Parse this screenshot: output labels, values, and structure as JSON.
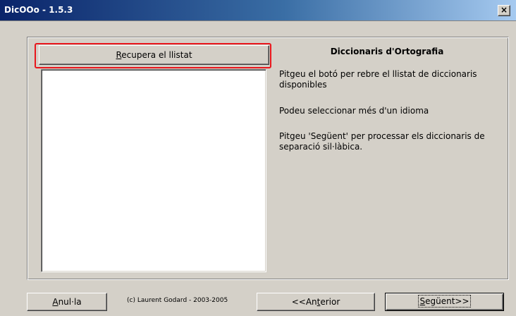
{
  "window": {
    "title": "DicOOo - 1.5.3",
    "close_symbol": "×",
    "close_icon": "close-icon"
  },
  "left_panel": {
    "retrieve_button": {
      "accel": "R",
      "rest": "ecupera el llistat"
    },
    "highlight_color": "#e8161c",
    "dictionary_list_items": []
  },
  "right_panel": {
    "heading": "Diccionaris d'Ortografia",
    "instruction_1": "Pitgeu el botó per rebre el llistat de diccionaris disponibles",
    "instruction_2": "Podeu seleccionar més d'un idioma",
    "instruction_3": "Pitgeu 'Següent' per processar els diccionaris de separació sil·làbica."
  },
  "footer": {
    "cancel_button": {
      "accel": "A",
      "rest": "nul·la"
    },
    "copyright": "(c) Laurent Godard - 2003-2005",
    "previous_button": {
      "before": "<<An",
      "accel": "t",
      "after": "erior"
    },
    "next_button": {
      "accel": "S",
      "rest": "egüent>>"
    }
  },
  "colors": {
    "dialog_background": "#d4d0c8",
    "title_bar": "#0a246a",
    "title_text": "#ffffff",
    "list_background": "#ffffff"
  }
}
